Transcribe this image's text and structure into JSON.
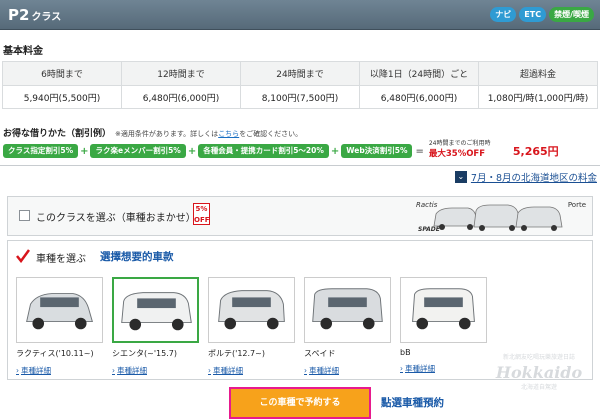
{
  "header": {
    "title": "P2",
    "title_suffix": "クラス",
    "chips": [
      "ナビ",
      "ETC",
      "禁煙/喫煙"
    ]
  },
  "basic_fee": {
    "title": "基本料金",
    "columns": [
      "6時間まで",
      "12時間まで",
      "24時間まで",
      "以降1日（24時間）ごと",
      "超過料金"
    ],
    "values": [
      "5,940円(5,500円)",
      "6,480円(6,000円)",
      "8,100円(7,500円)",
      "6,480円(6,000円)",
      "1,080円/時(1,000円/時)"
    ]
  },
  "deal": {
    "title": "お得な借りかた（割引例）",
    "note_pre": "※適用条件があります。詳しくは",
    "note_link": "こちら",
    "note_post": "をご確認ください。",
    "discounts": [
      "クラス指定割引5%",
      "ラク楽eメンバー割引5%",
      "各種会員・提携カード割引5～20%",
      "Web決済割引5%"
    ],
    "max_small": "24時間までのご利用時",
    "max_big": "最大35%OFF",
    "price": "5,265円"
  },
  "summer_link": "7月・8月の北海道地区の料金",
  "class_select": {
    "label": "このクラスを選ぶ（車種おまかせ）",
    "badge": "5% OFF",
    "brand1": "Ractis",
    "brand2": "Porte",
    "brand3": "SPADE"
  },
  "car_select": {
    "label": "車種を選ぶ",
    "zh": "選擇想要的車款",
    "cars": [
      {
        "name": "ラクティス('10.11~)",
        "detail": "車種詳細",
        "color": "#d9dde0"
      },
      {
        "name": "シエンタ(~'15.7)",
        "detail": "車種詳細",
        "color": "#f0f1f1"
      },
      {
        "name": "ポルテ('12.7~)",
        "detail": "車種詳細",
        "color": "#e1e3e4"
      },
      {
        "name": "スペイド",
        "detail": "車種詳細",
        "color": "#d9dcdf"
      },
      {
        "name": "bB",
        "detail": "車種詳細",
        "color": "#f2f2f0"
      }
    ],
    "selected_index": 1
  },
  "reserve_button": "この車種で予約する",
  "reserve_zh": "點選車種預約",
  "watermark": {
    "line1": "新北網友吃喝玩樂旅遊日誌",
    "line2": "Hokkaido",
    "line3": "北海道自駕遊"
  }
}
